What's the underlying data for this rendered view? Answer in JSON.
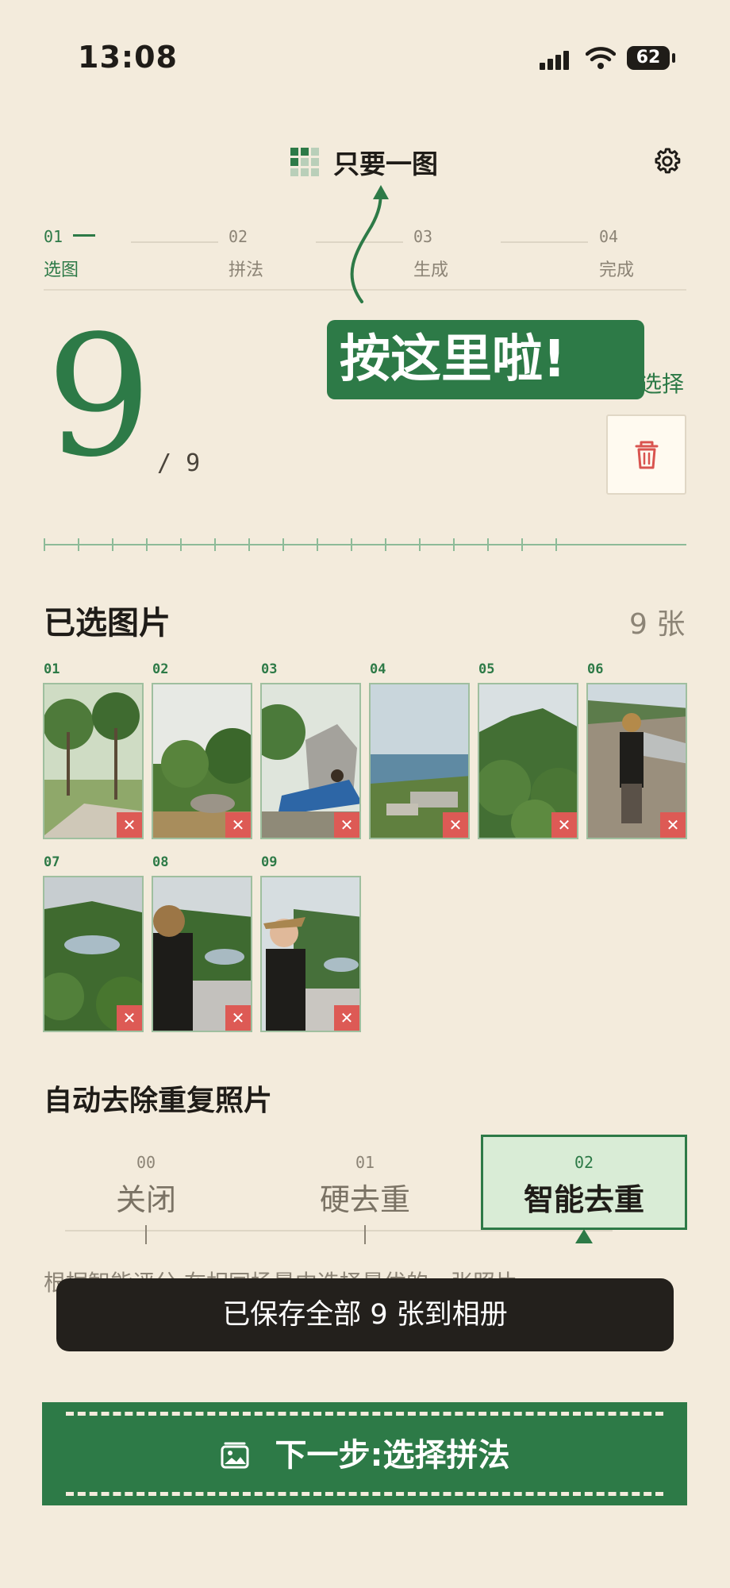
{
  "status_bar": {
    "time": "13:08",
    "battery": "62"
  },
  "header": {
    "title": "只要一图"
  },
  "steps": [
    {
      "num": "01",
      "label": "选图",
      "active": true
    },
    {
      "num": "02",
      "label": "拼法",
      "active": false
    },
    {
      "num": "03",
      "label": "生成",
      "active": false
    },
    {
      "num": "04",
      "label": "完成",
      "active": false
    }
  ],
  "counter": {
    "selected": "9",
    "total": "/ 9"
  },
  "overlay_tip": {
    "text": "按这里啦!"
  },
  "reselect_label": "选择",
  "selected_section": {
    "title": "已选图片",
    "count": "9 张",
    "photos": [
      {
        "num": "01"
      },
      {
        "num": "02"
      },
      {
        "num": "03"
      },
      {
        "num": "04"
      },
      {
        "num": "05"
      },
      {
        "num": "06"
      },
      {
        "num": "07"
      },
      {
        "num": "08"
      },
      {
        "num": "09"
      }
    ]
  },
  "dedup": {
    "title": "自动去除重复照片",
    "options": [
      {
        "num": "00",
        "label": "关闭"
      },
      {
        "num": "01",
        "label": "硬去重"
      },
      {
        "num": "02",
        "label": "智能去重"
      }
    ],
    "selected_option": "智能去重",
    "description": "根据智能评分,在相同场景中选择最优的一张照片"
  },
  "toast": {
    "text": "已保存全部 9 张到相册"
  },
  "next_button": {
    "label": "下一步:选择拼法"
  },
  "colors": {
    "accent": "#2d7a47",
    "background": "#f3ebdc",
    "delete": "#dd5a55"
  }
}
